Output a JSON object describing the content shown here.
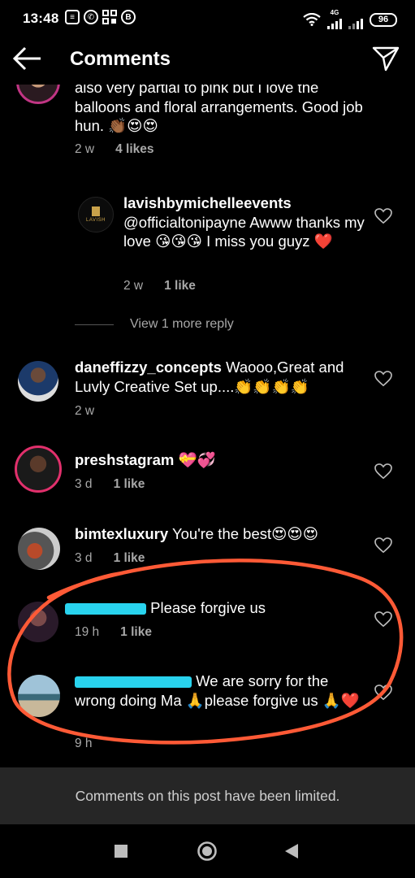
{
  "status_bar": {
    "time": "13:48",
    "battery": "96",
    "network": "4G",
    "left_icons": [
      "message-icon",
      "whatsapp-icon",
      "grid-app-icon",
      "b-app-icon"
    ],
    "right_icons": [
      "wifi-icon",
      "signal-icon",
      "battery-icon"
    ]
  },
  "header": {
    "title": "Comments",
    "back_icon": "back-arrow-icon",
    "send_icon": "send-direct-icon"
  },
  "comments": [
    {
      "id": "c1",
      "username": "",
      "text": "also very partial to pink but I love the balloons and floral arrangements. Good job hun. 👏🏾😍😍",
      "time": "2 w",
      "likes": "4 likes",
      "liked_icon": false
    },
    {
      "id": "r1",
      "username": "lavishbymichelleevents",
      "text": "@officialtonipayne Awww thanks my love 😘😘😘 I miss you guyz ❤️",
      "time": "2 w",
      "likes": "1 like",
      "avatar_text": "LAVISH"
    },
    {
      "id": "c2",
      "username": "daneffizzy_concepts",
      "text": "Waooo,Great and Luvly Creative Set up....👏👏👏👏",
      "time": "2 w",
      "likes": ""
    },
    {
      "id": "c3",
      "username": "preshstagram",
      "text": "💝💞",
      "time": "3 d",
      "likes": "1 like"
    },
    {
      "id": "c4",
      "username": "bimtexluxury",
      "text": "You're the best😍😍😍",
      "time": "3 d",
      "likes": "1 like"
    },
    {
      "id": "c5",
      "username": "",
      "text": "Please forgive us",
      "time": "19 h",
      "likes": "1 like"
    },
    {
      "id": "c6",
      "username": "",
      "text": "We are sorry for the wrong doing Ma 🙏please forgive us 🙏❤️",
      "time": "9 h",
      "likes": ""
    }
  ],
  "view_more_reply": "View 1 more reply",
  "limited_notice": "Comments on this post have been limited.",
  "colors": {
    "background": "#000000",
    "secondary_text": "#a8a8a8",
    "bottom_bar": "#262626",
    "annotation": "#ff5a36",
    "redaction": "#29d3ee"
  },
  "nav_bar": {
    "buttons": [
      "recents-square-icon",
      "home-circle-icon",
      "back-triangle-icon"
    ]
  }
}
